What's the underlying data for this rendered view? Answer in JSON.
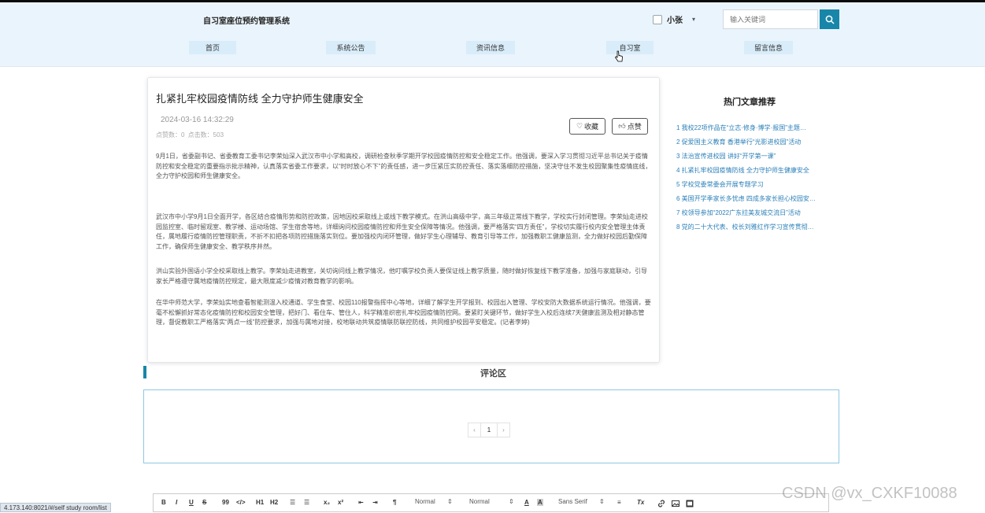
{
  "header": {
    "site_title": "自习室座位预约管理系统",
    "user_name": "小张",
    "search_placeholder": "输入关键词",
    "nav": [
      "首页",
      "系统公告",
      "资讯信息",
      "自习室",
      "留言信息"
    ]
  },
  "article": {
    "title": "扎紧扎牢校园疫情防线 全力守护师生健康安全",
    "time": "2024-03-16 14:32:29",
    "stats": "点赞数：0  点击数：503",
    "collect_label": "收藏",
    "like_label": "点赞",
    "paragraphs": [
      "9月1日，省委副书记、省委教育工委书记李荣灿深入武汉市中小学和高校，调研检查秋季学期开学校园疫情防控和安全稳定工作。他强调，要深入学习贯彻习近平总书记关于疫情防控和安全稳定的重要指示批示精神，认真落实省委工作要求，以“时时放心不下”的责任感，进一步压紧压实防控责任、落实落细防控措施，坚决守住不发生校园聚集性疫情底线，全力守护校园和师生健康安全。",
      "武汉市中小学9月1日全面开学，各区结合疫情形势和防控政策，因地因校采取线上或线下教学模式。在洪山高级中学，高三年级正常线下教学，学校实行封闭管理。李荣灿走进校园监控室、临时留观室、教学楼、运动场馆、学生宿舍等地，详细询问校园疫情防控和师生安全保障等情况。他强调，要严格落实“四方责任”，学校切实履行校内安全管理主体责任，属地履行疫情防控管理职责，不折不扣把各项防控措施落实到位。要加强校内闭环管理，做好学生心理辅导、教育引导等工作，加强教职工健康监测，全力做好校园后勤保障工作，确保师生健康安全、教学秩序井然。",
      "洪山实验外国语小学全校采取线上教学。李荣灿走进教室，关切询问线上教学情况，他叮嘱学校负责人要保证线上教学质量，随时做好恢复线下教学准备，加强与家庭联动，引导家长严格遵守属地疫情防控规定，最大限度减少疫情对教育教学的影响。",
      "在华中师范大学，李荣灿实地查看智能测温入校通道、学生食堂、校园110报警指挥中心等地，详细了解学生开学报到、校园出入管理、学校安防大数据系统运行情况。他强调，要毫不松懈抓好常态化疫情防控和校园安全管理，把好门、看住车、管住人，科学精准织密扎牢校园疫情防控网。要紧盯关键环节，做好学生入校后连续7天健康监测及相对静态管理，督促教职工严格落实“两点一线”防控要求，加强与属地对接，校地联动共筑疫情联防联控防线，共同维护校园平安稳定。(记者李婷)"
    ]
  },
  "hot": {
    "title": "热门文章推荐",
    "items": [
      "1  我校22项作品在“立志·修身·博学·报国”主题…",
      "2  促爱国主义教育 香港举行“光影进校园”活动",
      "3  法治宣传进校园 讲好“开学第一课”",
      "4  扎紧扎牢校园疫情防线 全力守护师生健康安全",
      "5  学校党委常委会开展专题学习",
      "6  美国开学季家长多忧虑 四成多家长担心校园安…",
      "7  校领导参加“2022广东拉美友城交流日”活动",
      "8  党的二十大代表、校长刘雅红作学习宣传贯彻…"
    ]
  },
  "comments": {
    "title": "评论区",
    "pager_prev": "‹",
    "pager_current": "1",
    "pager_next": "›"
  },
  "editor": {
    "bold": "B",
    "italic": "I",
    "underline": "U",
    "strike": "S",
    "quote": "99",
    "code": "</>",
    "h1": "H1",
    "h2": "H2",
    "ol": "☰",
    "ul": "☰",
    "sub": "x₂",
    "sup": "x²",
    "outdent": "⇤",
    "indent": "⇥",
    "rtl": "¶",
    "size": "Normal",
    "header": "Normal",
    "font": "Sans Serif",
    "color_a": "A",
    "bg_a": "A",
    "align": "≡",
    "clean": "Tx"
  },
  "status_url": "4.173.140:8021/#/self study room/list",
  "watermark": "CSDN @vx_CXKF10088",
  "colors": {
    "accent": "#1886a8",
    "header_bg": "#eaf4fc",
    "nav_bg": "#d9ecf9",
    "link": "#2a7fb8"
  }
}
